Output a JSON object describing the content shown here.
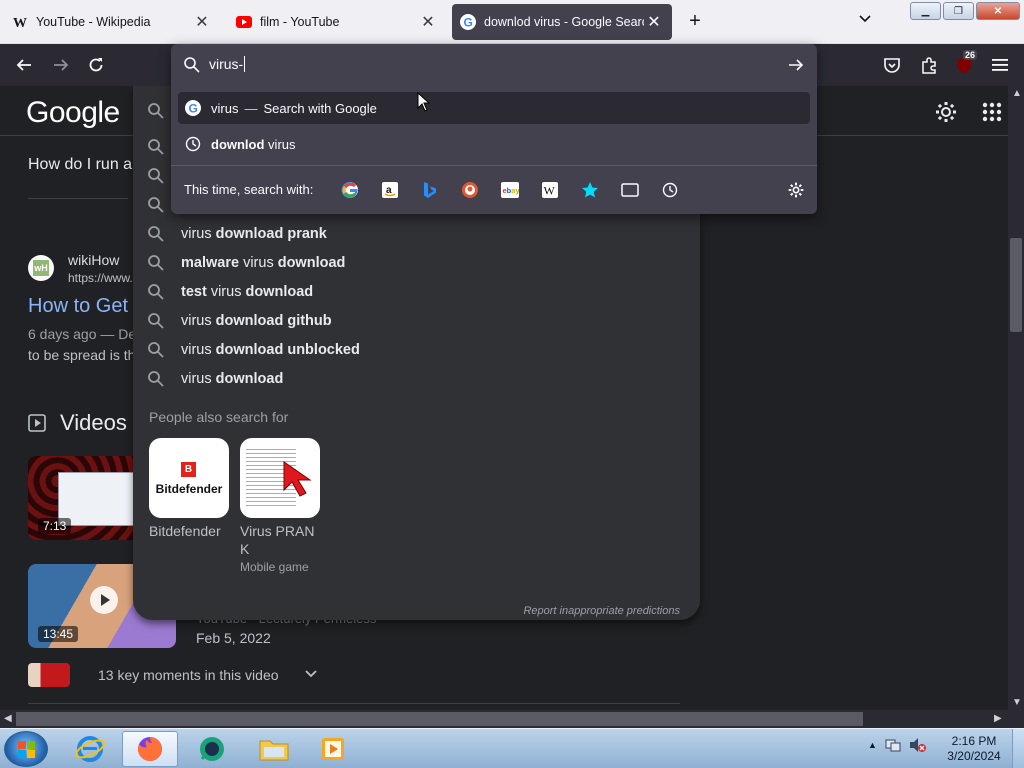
{
  "browser": {
    "tabs": [
      {
        "title": "YouTube - Wikipedia",
        "favicon": "wikipedia-w-icon",
        "active": false
      },
      {
        "title": "film - YouTube",
        "favicon": "youtube-icon",
        "active": false
      },
      {
        "title": "downlod virus - Google Search",
        "favicon": "google-g-icon",
        "active": true
      }
    ],
    "new_tab_label": "+",
    "extension_badge": "26",
    "urlbar": {
      "value": "virus-",
      "suggestions": [
        {
          "text": "virus",
          "separator": "—",
          "hint": "Search with Google",
          "icon": "google-g-icon",
          "selected": true
        },
        {
          "bold": "downlod",
          "rest": " virus",
          "icon": "history-clock-icon",
          "selected": false
        }
      ],
      "search_with_label": "This time, search with:",
      "engines": [
        "google",
        "amazon",
        "bing",
        "duckduckgo",
        "ebay",
        "wikipedia",
        "bookmarks",
        "tabs",
        "history"
      ]
    }
  },
  "page": {
    "logo": "Google",
    "question_partial": "How do I run a",
    "result": {
      "site_name": "wikiHow",
      "site_url": "https://www.",
      "title_partial": "How to Get",
      "meta_partial": "6 days ago — De",
      "snippet_partial": "to be spread is th"
    },
    "videos_heading": "Videos",
    "video_thumbs": [
      {
        "duration": "7:13"
      },
      {
        "duration": "13:45"
      }
    ],
    "video_source_partial": "YouTube · Lecturely Permeless",
    "video_date": "Feb 5, 2022",
    "key_moments": "13 key moments in this video",
    "suggestions": [
      {
        "parts": [
          {
            "t": "virus ",
            "b": false
          },
          {
            "t": "download prank",
            "b": true
          }
        ]
      },
      {
        "parts": [
          {
            "t": "malware",
            "b": true
          },
          {
            "t": " virus ",
            "b": false
          },
          {
            "t": "download",
            "b": true
          }
        ]
      },
      {
        "parts": [
          {
            "t": "test",
            "b": true
          },
          {
            "t": " virus ",
            "b": false
          },
          {
            "t": "download",
            "b": true
          }
        ]
      },
      {
        "parts": [
          {
            "t": "virus ",
            "b": false
          },
          {
            "t": "download github",
            "b": true
          }
        ]
      },
      {
        "parts": [
          {
            "t": "virus ",
            "b": false
          },
          {
            "t": "download unblocked",
            "b": true
          }
        ]
      },
      {
        "parts": [
          {
            "t": "virus ",
            "b": false
          },
          {
            "t": "download",
            "b": true
          }
        ]
      }
    ],
    "people_also_search_label": "People also search for",
    "people_also_search": [
      {
        "name": "Bitdefender",
        "sub": "",
        "logo_text": "Bitdefender",
        "logo_letter": "B"
      },
      {
        "name": "Virus PRAN\nK",
        "sub": "Mobile game"
      }
    ],
    "report_text": "Report inappropriate predictions"
  },
  "taskbar": {
    "apps": [
      "internet-explorer",
      "firefox",
      "chat-app",
      "file-explorer",
      "media-player"
    ],
    "active_app": "firefox",
    "time": "2:16 PM",
    "date": "3/20/2024"
  },
  "colors": {
    "google_dark_bg": "#202124",
    "link_blue": "#8ab4f8",
    "firefox_toolbar": "#2b2a33",
    "firefox_popup": "#42414d"
  }
}
